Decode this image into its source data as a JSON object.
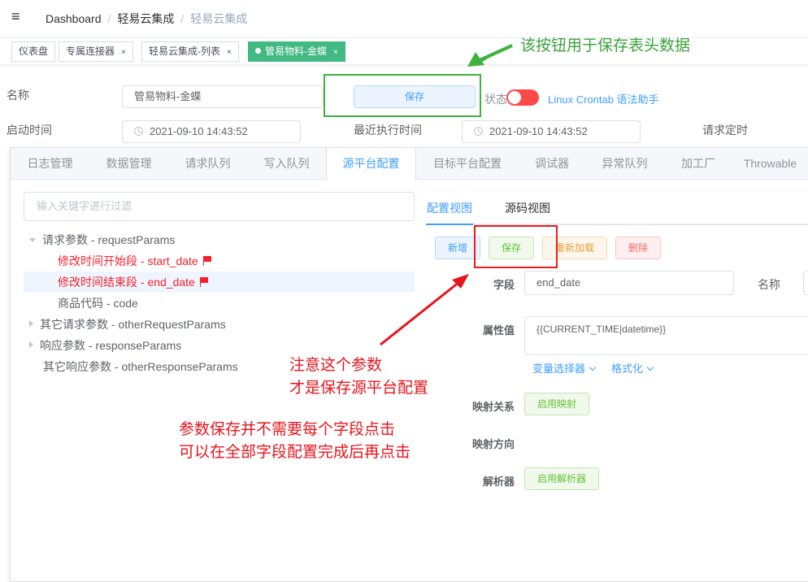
{
  "header": {
    "breadcrumb": [
      "Dashboard",
      "轻易云集成",
      "轻易云集成"
    ]
  },
  "tags": [
    {
      "label": "仪表盘"
    },
    {
      "label": "专属连接器"
    },
    {
      "label": "轻易云集成-列表"
    },
    {
      "label": "管易物料-金蝶"
    }
  ],
  "form": {
    "name_label": "名称",
    "name_value": "管易物料-金蝶",
    "save_label": "保存",
    "status_label": "状态",
    "crontab_link": "Linux Crontab 语法助手",
    "start_label": "启动时间",
    "start_value": "2021-09-10 14:43:52",
    "last_label": "最近执行时间",
    "last_value": "2021-09-10 14:43:52",
    "req_label": "请求定时"
  },
  "tabs": [
    "日志管理",
    "数据管理",
    "请求队列",
    "写入队列",
    "源平台配置",
    "目标平台配置",
    "调试器",
    "异常队列",
    "加工厂",
    "Throwable"
  ],
  "tree": {
    "filter_placeholder": "输入关键字进行过滤",
    "nodes": [
      {
        "label": "请求参数 - requestParams"
      },
      {
        "label": "修改时间开始段 - start_date"
      },
      {
        "label": "修改时间结束段 - end_date"
      },
      {
        "label": "商品代码 - code"
      },
      {
        "label": "其它请求参数 - otherRequestParams"
      },
      {
        "label": "响应参数 - responseParams"
      },
      {
        "label": "其它响应参数 - otherResponseParams"
      }
    ]
  },
  "editor": {
    "subtabs": [
      "配置视图",
      "源码视图"
    ],
    "buttons": {
      "add": "新增",
      "save": "保存",
      "reload": "重新加载",
      "delete": "删除"
    },
    "field_label": "字段",
    "field_value": "end_date",
    "name_label": "名称",
    "attr_label": "属性值",
    "attr_value": "{{CURRENT_TIME|datetime}}",
    "var_selector": "变量选择器",
    "format": "格式化",
    "mapping_label": "映射关系",
    "mapping_btn": "启用映射",
    "direction_label": "映射方向",
    "parser_label": "解析器",
    "parser_btn": "启用解析器"
  },
  "annotations": {
    "green_note": "该按钮用于保存表头数据",
    "red_note_1": "注意这个参数",
    "red_note_2": "才是保存源平台配置",
    "red_note_3": "参数保存并不需要每个字段点击",
    "red_note_4": "可以在全部字段配置完成后再点击"
  },
  "colors": {
    "primary": "#409eff",
    "tag_active": "#42b983",
    "switch_off": "#ff4949",
    "annotation_green": "#3aa23a",
    "annotation_red": "#e8141c"
  }
}
